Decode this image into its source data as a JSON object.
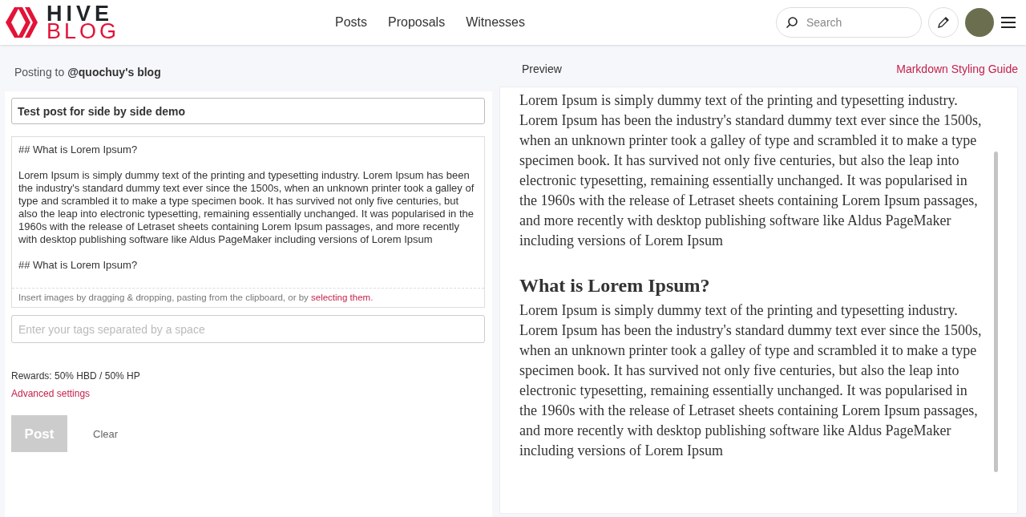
{
  "header": {
    "logo_top": "HIVE",
    "logo_bottom": "BLOG",
    "nav": [
      {
        "label": "Posts"
      },
      {
        "label": "Proposals"
      },
      {
        "label": "Witnesses"
      }
    ],
    "search": {
      "placeholder": "Search"
    }
  },
  "editor": {
    "posting_to": "Posting to **@quochuy's blog**",
    "title": "Test post for side by side demo",
    "body": "## What is Lorem Ipsum?\n\nLorem Ipsum is simply dummy text of the printing and typesetting industry. Lorem Ipsum has been the industry's standard dummy text ever since the 1500s, when an unknown printer took a galley of type and scrambled it to make a type specimen book. It has survived not only five centuries, but also the leap into electronic typesetting, remaining essentially unchanged. It was popularised in the 1960s with the release of Letraset sheets containing Lorem Ipsum passages, and more recently with desktop publishing software like Aldus PageMaker including versions of Lorem Ipsum\n\n## What is Lorem Ipsum?",
    "upload_hint": "Insert images by dragging & dropping, pasting from the clipboard, or by",
    "upload_link": "selecting them",
    "upload_end": ".",
    "tags": {
      "placeholder": "Enter your tags separated by a space"
    },
    "rewards": "Rewards: 50% HBD / 50% HP",
    "advanced": "Advanced settings",
    "buttons": [
      {
        "label": "Post",
        "kind": "primary",
        "disabled": true
      },
      {
        "label": "Clear",
        "kind": "plain",
        "disabled": false
      }
    ]
  },
  "preview": {
    "label": "Preview",
    "guide": "Markdown Styling Guide",
    "blocks": [
      {
        "kind": "paragraph",
        "text": "Lorem Ipsum is simply dummy text of the printing and typesetting industry. Lorem Ipsum has been the industry's standard dummy text ever since the 1500s, when an unknown printer took a galley of type and scrambled it to make a type specimen book. It has survived not only five centuries, but also the leap into electronic typesetting, remaining essentially unchanged. It was popularised in the 1960s with the release of Letraset sheets containing Lorem Ipsum passages, and more recently with desktop publishing software like Aldus PageMaker including versions of Lorem Ipsum"
      },
      {
        "kind": "heading",
        "text": "What is Lorem Ipsum?"
      },
      {
        "kind": "paragraph",
        "text": "Lorem Ipsum is simply dummy text of the printing and typesetting industry. Lorem Ipsum has been the industry's standard dummy text ever since the 1500s, when an unknown printer took a galley of type and scrambled it to make a type specimen book. It has survived not only five centuries, but also the leap into electronic typesetting, remaining essentially unchanged. It was popularised in the 1960s with the release of Letraset sheets containing Lorem Ipsum passages, and more recently with desktop publishing software like Aldus PageMaker including versions of Lorem Ipsum"
      }
    ]
  }
}
